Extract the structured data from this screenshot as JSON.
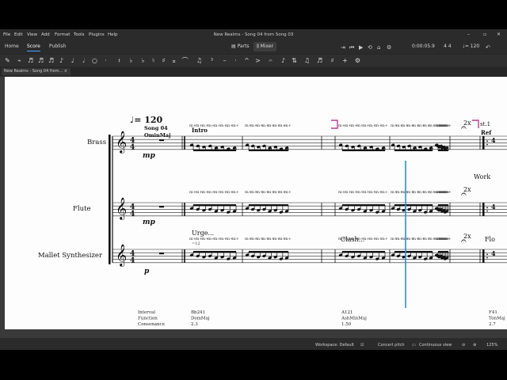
{
  "window": {
    "title": "New Realms - Song 04 from Song 03",
    "controls": [
      "–",
      "▫",
      "✕"
    ]
  },
  "menu": [
    "File",
    "Edit",
    "View",
    "Add",
    "Format",
    "Tools",
    "Plugins",
    "Help"
  ],
  "nav_tabs": {
    "home": "Home",
    "score": "Score",
    "publish": "Publish"
  },
  "toolbar": {
    "parts_label": "Parts",
    "mixer_label": "Mixer",
    "time": "0:00:05.9",
    "time_signature": "4 4",
    "tempo": "♩= 120"
  },
  "document_tab": {
    "label": "New Realms - Song 04 from...",
    "close": "×"
  },
  "score": {
    "tempo_mark": "♩= 120",
    "title_line1": "Song 04",
    "title_line2": "OminMaj",
    "section_intro": "Intro",
    "instruments": [
      "Brass",
      "Flute",
      "Mallet Synthesizer"
    ],
    "dynamics": {
      "brass": "mp",
      "flute": "mp",
      "mallet": "p"
    },
    "repeat_2x": "2x",
    "m_plus": "m+",
    "st1": "st.1",
    "ref": "Ref",
    "work": "Work",
    "urge": "Urge...",
    "clash": "Clash...",
    "flo": "Flo",
    "eq12": "=12",
    "analysis": {
      "header": [
        "Interval",
        "Function",
        "Consonance"
      ],
      "col1": [
        "Bb241",
        "DomMaj",
        "2.3"
      ],
      "col2": [
        "A121",
        "AshMinMaj",
        "1.50"
      ],
      "col3": [
        "F41",
        "TonMaj",
        "2.7"
      ]
    }
  },
  "status": {
    "workspace": "Workspace: Default",
    "concert_pitch": "Concert pitch",
    "view_mode": "Continuous view",
    "zoom": "125%"
  },
  "colors": {
    "accent": "#4aa3ff",
    "playhead": "#2a8fd6",
    "repeat_marker": "#c0398f",
    "app_bg": "#2b2b2b",
    "paper": "#fdfdfd"
  }
}
